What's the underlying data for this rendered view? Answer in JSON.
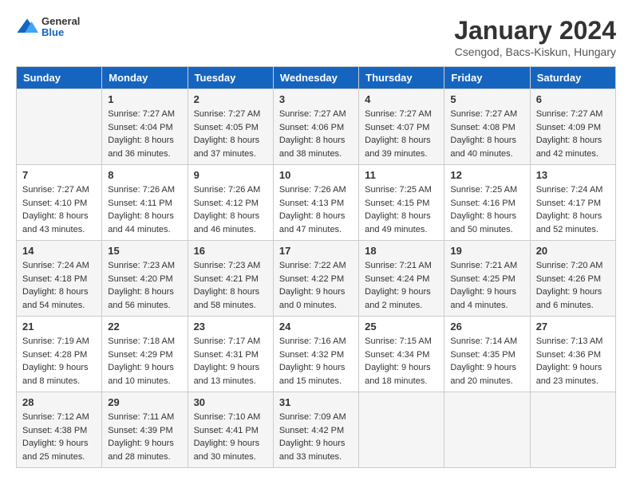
{
  "header": {
    "logo": {
      "general": "General",
      "blue": "Blue"
    },
    "title": "January 2024",
    "location": "Csengod, Bacs-Kiskun, Hungary"
  },
  "days_of_week": [
    "Sunday",
    "Monday",
    "Tuesday",
    "Wednesday",
    "Thursday",
    "Friday",
    "Saturday"
  ],
  "weeks": [
    [
      {
        "day": "",
        "sunrise": "",
        "sunset": "",
        "daylight": ""
      },
      {
        "day": "1",
        "sunrise": "Sunrise: 7:27 AM",
        "sunset": "Sunset: 4:04 PM",
        "daylight": "Daylight: 8 hours and 36 minutes."
      },
      {
        "day": "2",
        "sunrise": "Sunrise: 7:27 AM",
        "sunset": "Sunset: 4:05 PM",
        "daylight": "Daylight: 8 hours and 37 minutes."
      },
      {
        "day": "3",
        "sunrise": "Sunrise: 7:27 AM",
        "sunset": "Sunset: 4:06 PM",
        "daylight": "Daylight: 8 hours and 38 minutes."
      },
      {
        "day": "4",
        "sunrise": "Sunrise: 7:27 AM",
        "sunset": "Sunset: 4:07 PM",
        "daylight": "Daylight: 8 hours and 39 minutes."
      },
      {
        "day": "5",
        "sunrise": "Sunrise: 7:27 AM",
        "sunset": "Sunset: 4:08 PM",
        "daylight": "Daylight: 8 hours and 40 minutes."
      },
      {
        "day": "6",
        "sunrise": "Sunrise: 7:27 AM",
        "sunset": "Sunset: 4:09 PM",
        "daylight": "Daylight: 8 hours and 42 minutes."
      }
    ],
    [
      {
        "day": "7",
        "sunrise": "Sunrise: 7:27 AM",
        "sunset": "Sunset: 4:10 PM",
        "daylight": "Daylight: 8 hours and 43 minutes."
      },
      {
        "day": "8",
        "sunrise": "Sunrise: 7:26 AM",
        "sunset": "Sunset: 4:11 PM",
        "daylight": "Daylight: 8 hours and 44 minutes."
      },
      {
        "day": "9",
        "sunrise": "Sunrise: 7:26 AM",
        "sunset": "Sunset: 4:12 PM",
        "daylight": "Daylight: 8 hours and 46 minutes."
      },
      {
        "day": "10",
        "sunrise": "Sunrise: 7:26 AM",
        "sunset": "Sunset: 4:13 PM",
        "daylight": "Daylight: 8 hours and 47 minutes."
      },
      {
        "day": "11",
        "sunrise": "Sunrise: 7:25 AM",
        "sunset": "Sunset: 4:15 PM",
        "daylight": "Daylight: 8 hours and 49 minutes."
      },
      {
        "day": "12",
        "sunrise": "Sunrise: 7:25 AM",
        "sunset": "Sunset: 4:16 PM",
        "daylight": "Daylight: 8 hours and 50 minutes."
      },
      {
        "day": "13",
        "sunrise": "Sunrise: 7:24 AM",
        "sunset": "Sunset: 4:17 PM",
        "daylight": "Daylight: 8 hours and 52 minutes."
      }
    ],
    [
      {
        "day": "14",
        "sunrise": "Sunrise: 7:24 AM",
        "sunset": "Sunset: 4:18 PM",
        "daylight": "Daylight: 8 hours and 54 minutes."
      },
      {
        "day": "15",
        "sunrise": "Sunrise: 7:23 AM",
        "sunset": "Sunset: 4:20 PM",
        "daylight": "Daylight: 8 hours and 56 minutes."
      },
      {
        "day": "16",
        "sunrise": "Sunrise: 7:23 AM",
        "sunset": "Sunset: 4:21 PM",
        "daylight": "Daylight: 8 hours and 58 minutes."
      },
      {
        "day": "17",
        "sunrise": "Sunrise: 7:22 AM",
        "sunset": "Sunset: 4:22 PM",
        "daylight": "Daylight: 9 hours and 0 minutes."
      },
      {
        "day": "18",
        "sunrise": "Sunrise: 7:21 AM",
        "sunset": "Sunset: 4:24 PM",
        "daylight": "Daylight: 9 hours and 2 minutes."
      },
      {
        "day": "19",
        "sunrise": "Sunrise: 7:21 AM",
        "sunset": "Sunset: 4:25 PM",
        "daylight": "Daylight: 9 hours and 4 minutes."
      },
      {
        "day": "20",
        "sunrise": "Sunrise: 7:20 AM",
        "sunset": "Sunset: 4:26 PM",
        "daylight": "Daylight: 9 hours and 6 minutes."
      }
    ],
    [
      {
        "day": "21",
        "sunrise": "Sunrise: 7:19 AM",
        "sunset": "Sunset: 4:28 PM",
        "daylight": "Daylight: 9 hours and 8 minutes."
      },
      {
        "day": "22",
        "sunrise": "Sunrise: 7:18 AM",
        "sunset": "Sunset: 4:29 PM",
        "daylight": "Daylight: 9 hours and 10 minutes."
      },
      {
        "day": "23",
        "sunrise": "Sunrise: 7:17 AM",
        "sunset": "Sunset: 4:31 PM",
        "daylight": "Daylight: 9 hours and 13 minutes."
      },
      {
        "day": "24",
        "sunrise": "Sunrise: 7:16 AM",
        "sunset": "Sunset: 4:32 PM",
        "daylight": "Daylight: 9 hours and 15 minutes."
      },
      {
        "day": "25",
        "sunrise": "Sunrise: 7:15 AM",
        "sunset": "Sunset: 4:34 PM",
        "daylight": "Daylight: 9 hours and 18 minutes."
      },
      {
        "day": "26",
        "sunrise": "Sunrise: 7:14 AM",
        "sunset": "Sunset: 4:35 PM",
        "daylight": "Daylight: 9 hours and 20 minutes."
      },
      {
        "day": "27",
        "sunrise": "Sunrise: 7:13 AM",
        "sunset": "Sunset: 4:36 PM",
        "daylight": "Daylight: 9 hours and 23 minutes."
      }
    ],
    [
      {
        "day": "28",
        "sunrise": "Sunrise: 7:12 AM",
        "sunset": "Sunset: 4:38 PM",
        "daylight": "Daylight: 9 hours and 25 minutes."
      },
      {
        "day": "29",
        "sunrise": "Sunrise: 7:11 AM",
        "sunset": "Sunset: 4:39 PM",
        "daylight": "Daylight: 9 hours and 28 minutes."
      },
      {
        "day": "30",
        "sunrise": "Sunrise: 7:10 AM",
        "sunset": "Sunset: 4:41 PM",
        "daylight": "Daylight: 9 hours and 30 minutes."
      },
      {
        "day": "31",
        "sunrise": "Sunrise: 7:09 AM",
        "sunset": "Sunset: 4:42 PM",
        "daylight": "Daylight: 9 hours and 33 minutes."
      },
      {
        "day": "",
        "sunrise": "",
        "sunset": "",
        "daylight": ""
      },
      {
        "day": "",
        "sunrise": "",
        "sunset": "",
        "daylight": ""
      },
      {
        "day": "",
        "sunrise": "",
        "sunset": "",
        "daylight": ""
      }
    ]
  ]
}
